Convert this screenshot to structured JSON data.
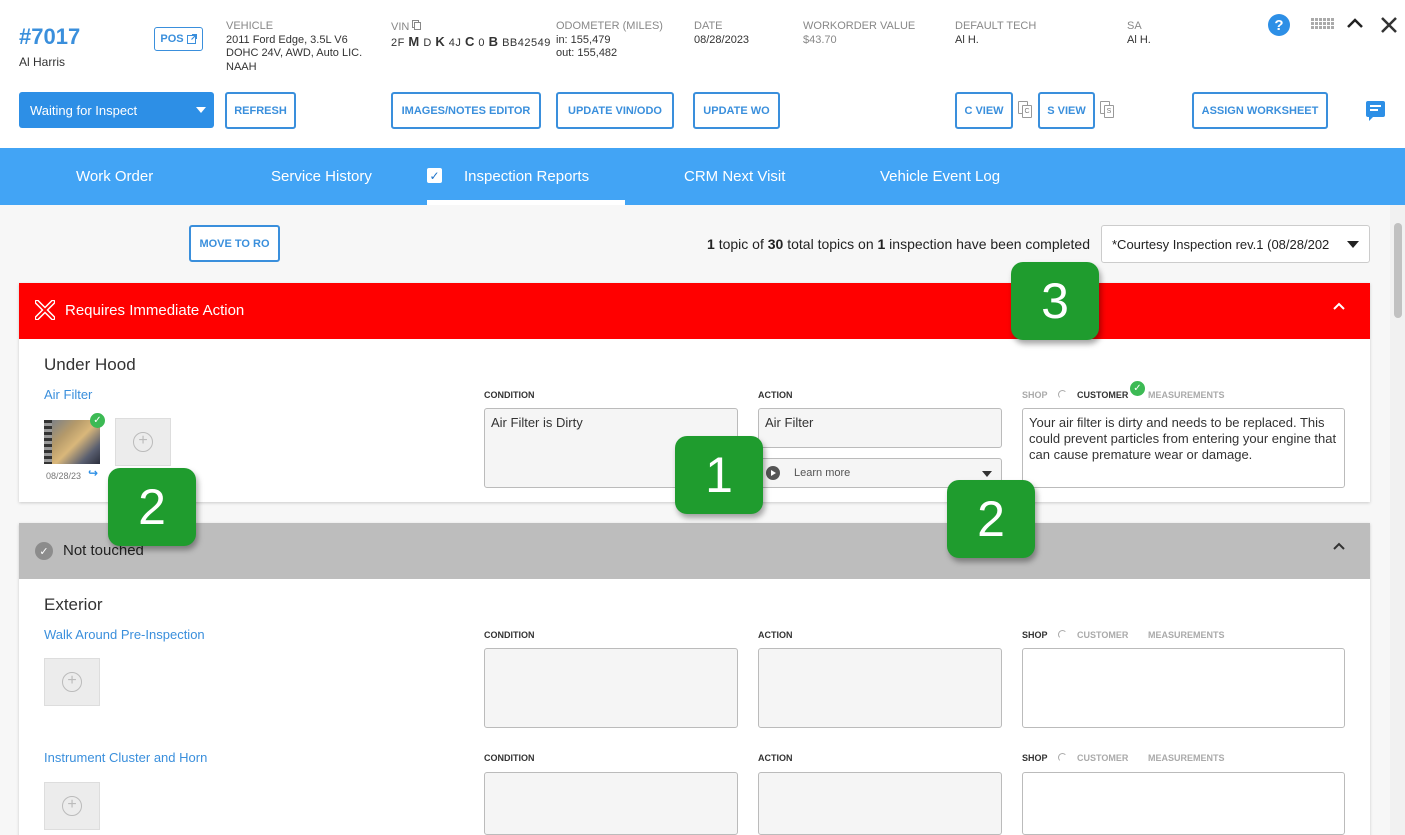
{
  "header": {
    "wo_number": "#7017",
    "customer": "Al Harris",
    "pos_label": "POS",
    "vehicle": {
      "label": "VEHICLE",
      "line1": "2011 Ford Edge, 3.5L V6",
      "line2": "DOHC 24V, AWD, Auto LIC.",
      "line3": "NAAH"
    },
    "vin": {
      "label": "VIN",
      "p1": "2F",
      "p2": "M",
      "p3": "D",
      "p4": "K",
      "p5": "4J",
      "p6": "C",
      "p7": "0",
      "p8": "B",
      "p9": "BB42549"
    },
    "odometer": {
      "label": "ODOMETER (MILES)",
      "in": "in: 155,479",
      "out": "out: 155,482"
    },
    "date": {
      "label": "DATE",
      "value": "08/28/2023"
    },
    "wo_value": {
      "label": "WORKORDER VALUE",
      "value": "$43.70"
    },
    "default_tech": {
      "label": "DEFAULT TECH",
      "value": "Al H."
    },
    "sa": {
      "label": "SA",
      "value": "Al H."
    },
    "help": "?"
  },
  "toolbar": {
    "status": "Waiting for Inspect",
    "refresh": "REFRESH",
    "images_notes": "IMAGES/NOTES EDITOR",
    "update_vin": "UPDATE VIN/ODO",
    "update_wo": "UPDATE WO",
    "c_view": "C VIEW",
    "s_view": "S VIEW",
    "assign_worksheet": "ASSIGN WORKSHEET",
    "copy_c": "C",
    "copy_s": "S"
  },
  "tabs": [
    "Work Order",
    "Service History",
    "Inspection Reports",
    "CRM Next Visit",
    "Vehicle Event Log"
  ],
  "inspection": {
    "move_to_ro": "MOVE TO RO",
    "summary": {
      "n1": "1",
      "t1": " topic of ",
      "n2": "30",
      "t2": " total topics on ",
      "n3": "1",
      "t3": " inspection have been completed"
    },
    "selected": "*Courtesy Inspection rev.1 (08/28/202"
  },
  "sections": {
    "immediate": {
      "title": "Requires Immediate Action"
    },
    "not_touched": {
      "title": "Not touched"
    }
  },
  "labels": {
    "condition": "CONDITION",
    "action": "ACTION",
    "shop": "SHOP",
    "customer": "CUSTOMER",
    "measurements": "MEASUREMENTS"
  },
  "under_hood": {
    "group": "Under Hood",
    "topic": "Air Filter",
    "photo_date": "08/28/23",
    "condition": "Air Filter is Dirty",
    "action": "Air Filter",
    "learn_more": "Learn more",
    "customer_note": "Your air filter is dirty and needs to be replaced. This could prevent particles from entering your engine that can cause premature wear or damage."
  },
  "exterior": {
    "group": "Exterior",
    "topic1": "Walk Around Pre-Inspection",
    "topic2": "Instrument Cluster and Horn"
  },
  "callouts": [
    "1",
    "2",
    "2",
    "3"
  ],
  "colors": {
    "accent": "#3a8fdc",
    "tabbar": "#42a4f5",
    "alert": "#ff0000",
    "callout": "#1f9c2e"
  }
}
